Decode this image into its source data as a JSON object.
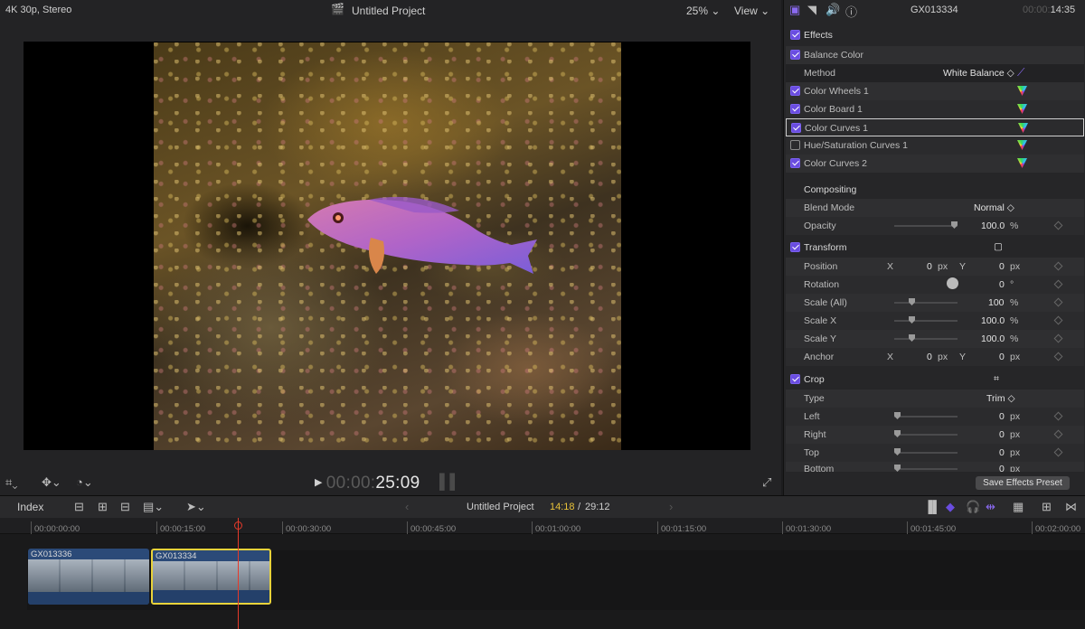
{
  "viewer": {
    "format": "4K 30p, Stereo",
    "project_title": "Untitled Project",
    "zoom": "25%",
    "view_label": "View",
    "timecode_dim": "00:00:",
    "timecode": "25:09"
  },
  "inspector": {
    "clip_name": "GX013334",
    "timecode_dim": "00:00:",
    "timecode": "14:35",
    "effects": {
      "header": "Effects",
      "items": [
        {
          "label": "Balance Color",
          "checked": true
        },
        {
          "label": "Color Wheels 1",
          "checked": true
        },
        {
          "label": "Color Board 1",
          "checked": true
        },
        {
          "label": "Color Curves 1",
          "checked": true
        },
        {
          "label": "Hue/Saturation Curves 1",
          "checked": false
        },
        {
          "label": "Color Curves 2",
          "checked": true
        }
      ],
      "method_label": "Method",
      "method_value": "White Balance ◇"
    },
    "compositing": {
      "header": "Compositing",
      "blend_label": "Blend Mode",
      "blend_value": "Normal ◇",
      "opacity_label": "Opacity",
      "opacity_value": "100.0",
      "opacity_unit": "%"
    },
    "transform": {
      "header": "Transform",
      "position_label": "Position",
      "x_label": "X",
      "y_label": "Y",
      "pos_x": "0",
      "pos_y": "0",
      "px": "px",
      "rotation_label": "Rotation",
      "rotation_value": "0",
      "deg": "°",
      "scale_all_label": "Scale (All)",
      "scale_all_value": "100",
      "scale_x_label": "Scale X",
      "scale_x_value": "100.0",
      "scale_y_label": "Scale Y",
      "scale_y_value": "100.0",
      "pct": "%",
      "anchor_label": "Anchor",
      "anchor_x": "0",
      "anchor_y": "0"
    },
    "crop": {
      "header": "Crop",
      "type_label": "Type",
      "type_value": "Trim ◇",
      "left_label": "Left",
      "right_label": "Right",
      "top_label": "Top",
      "bottom_label": "Bottom",
      "zero": "0",
      "px": "px"
    },
    "save_preset": "Save Effects Preset"
  },
  "timeline": {
    "index_label": "Index",
    "project_title": "Untitled Project",
    "current_time": "14:18",
    "separator": "/",
    "duration": "29:12",
    "ruler": [
      "00:00:00:00",
      "00:00:15:00",
      "00:00:30:00",
      "00:00:45:00",
      "00:01:00:00",
      "00:01:15:00",
      "00:01:30:00",
      "00:01:45:00",
      "00:02:00:00"
    ],
    "clips": [
      {
        "name": "GX013336"
      },
      {
        "name": "GX013334"
      }
    ]
  },
  "colors": {
    "accent": "#6a4de0",
    "playhead": "#e53a2a",
    "selection": "#e8d23a"
  }
}
